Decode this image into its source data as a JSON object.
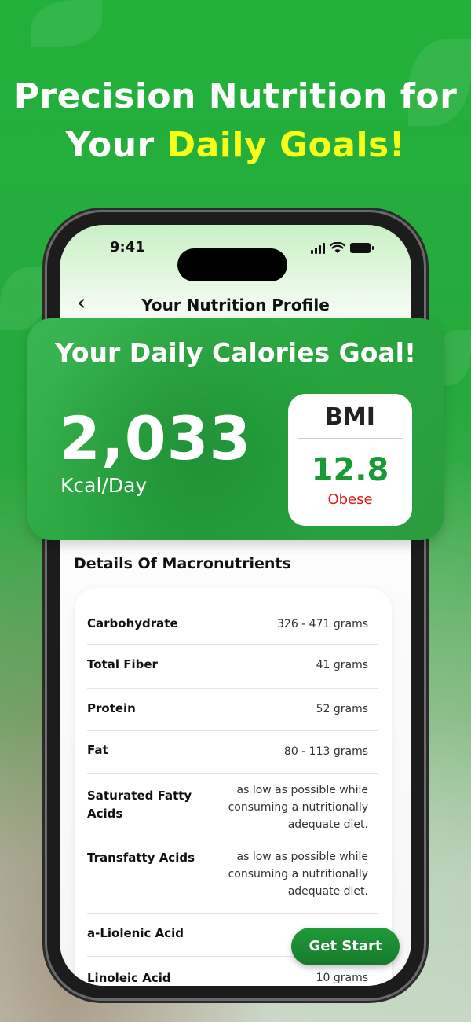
{
  "headline": {
    "line1": "Precision Nutrition for",
    "line2_prefix": "Your ",
    "line2_highlight": "Daily Goals!"
  },
  "status_bar": {
    "time": "9:41"
  },
  "nav": {
    "title": "Your Nutrition Profile"
  },
  "calories": {
    "title": "Your Daily Calories Goal!",
    "value": "2,033",
    "unit": "Kcal/Day"
  },
  "bmi": {
    "label": "BMI",
    "value": "12.8",
    "status": "Obese"
  },
  "macros": {
    "title": "Details Of Macronutrients",
    "rows": [
      {
        "name": "Carbohydrate",
        "value": "326 - 471 grams"
      },
      {
        "name": "Total Fiber",
        "value": "41 grams"
      },
      {
        "name": "Protein",
        "value": "52 grams"
      },
      {
        "name": "Fat",
        "value": "80 - 113 grams"
      },
      {
        "name": "Saturated Fatty Acids",
        "value": "as low as possible while consuming a nutritionally adequate diet."
      },
      {
        "name": "Transfatty Acids",
        "value": "as low as possible while consuming a nutritionally adequate diet."
      },
      {
        "name": "a-Liolenic Acid",
        "value": ""
      },
      {
        "name": "Linoleic Acid",
        "value": "10 grams"
      }
    ]
  },
  "cta": {
    "label": "Get Start"
  },
  "colors": {
    "brand_green": "#27a53e",
    "highlight": "#f6ff1a",
    "bmi_value": "#1a9a37",
    "bmi_status": "#e01919"
  }
}
